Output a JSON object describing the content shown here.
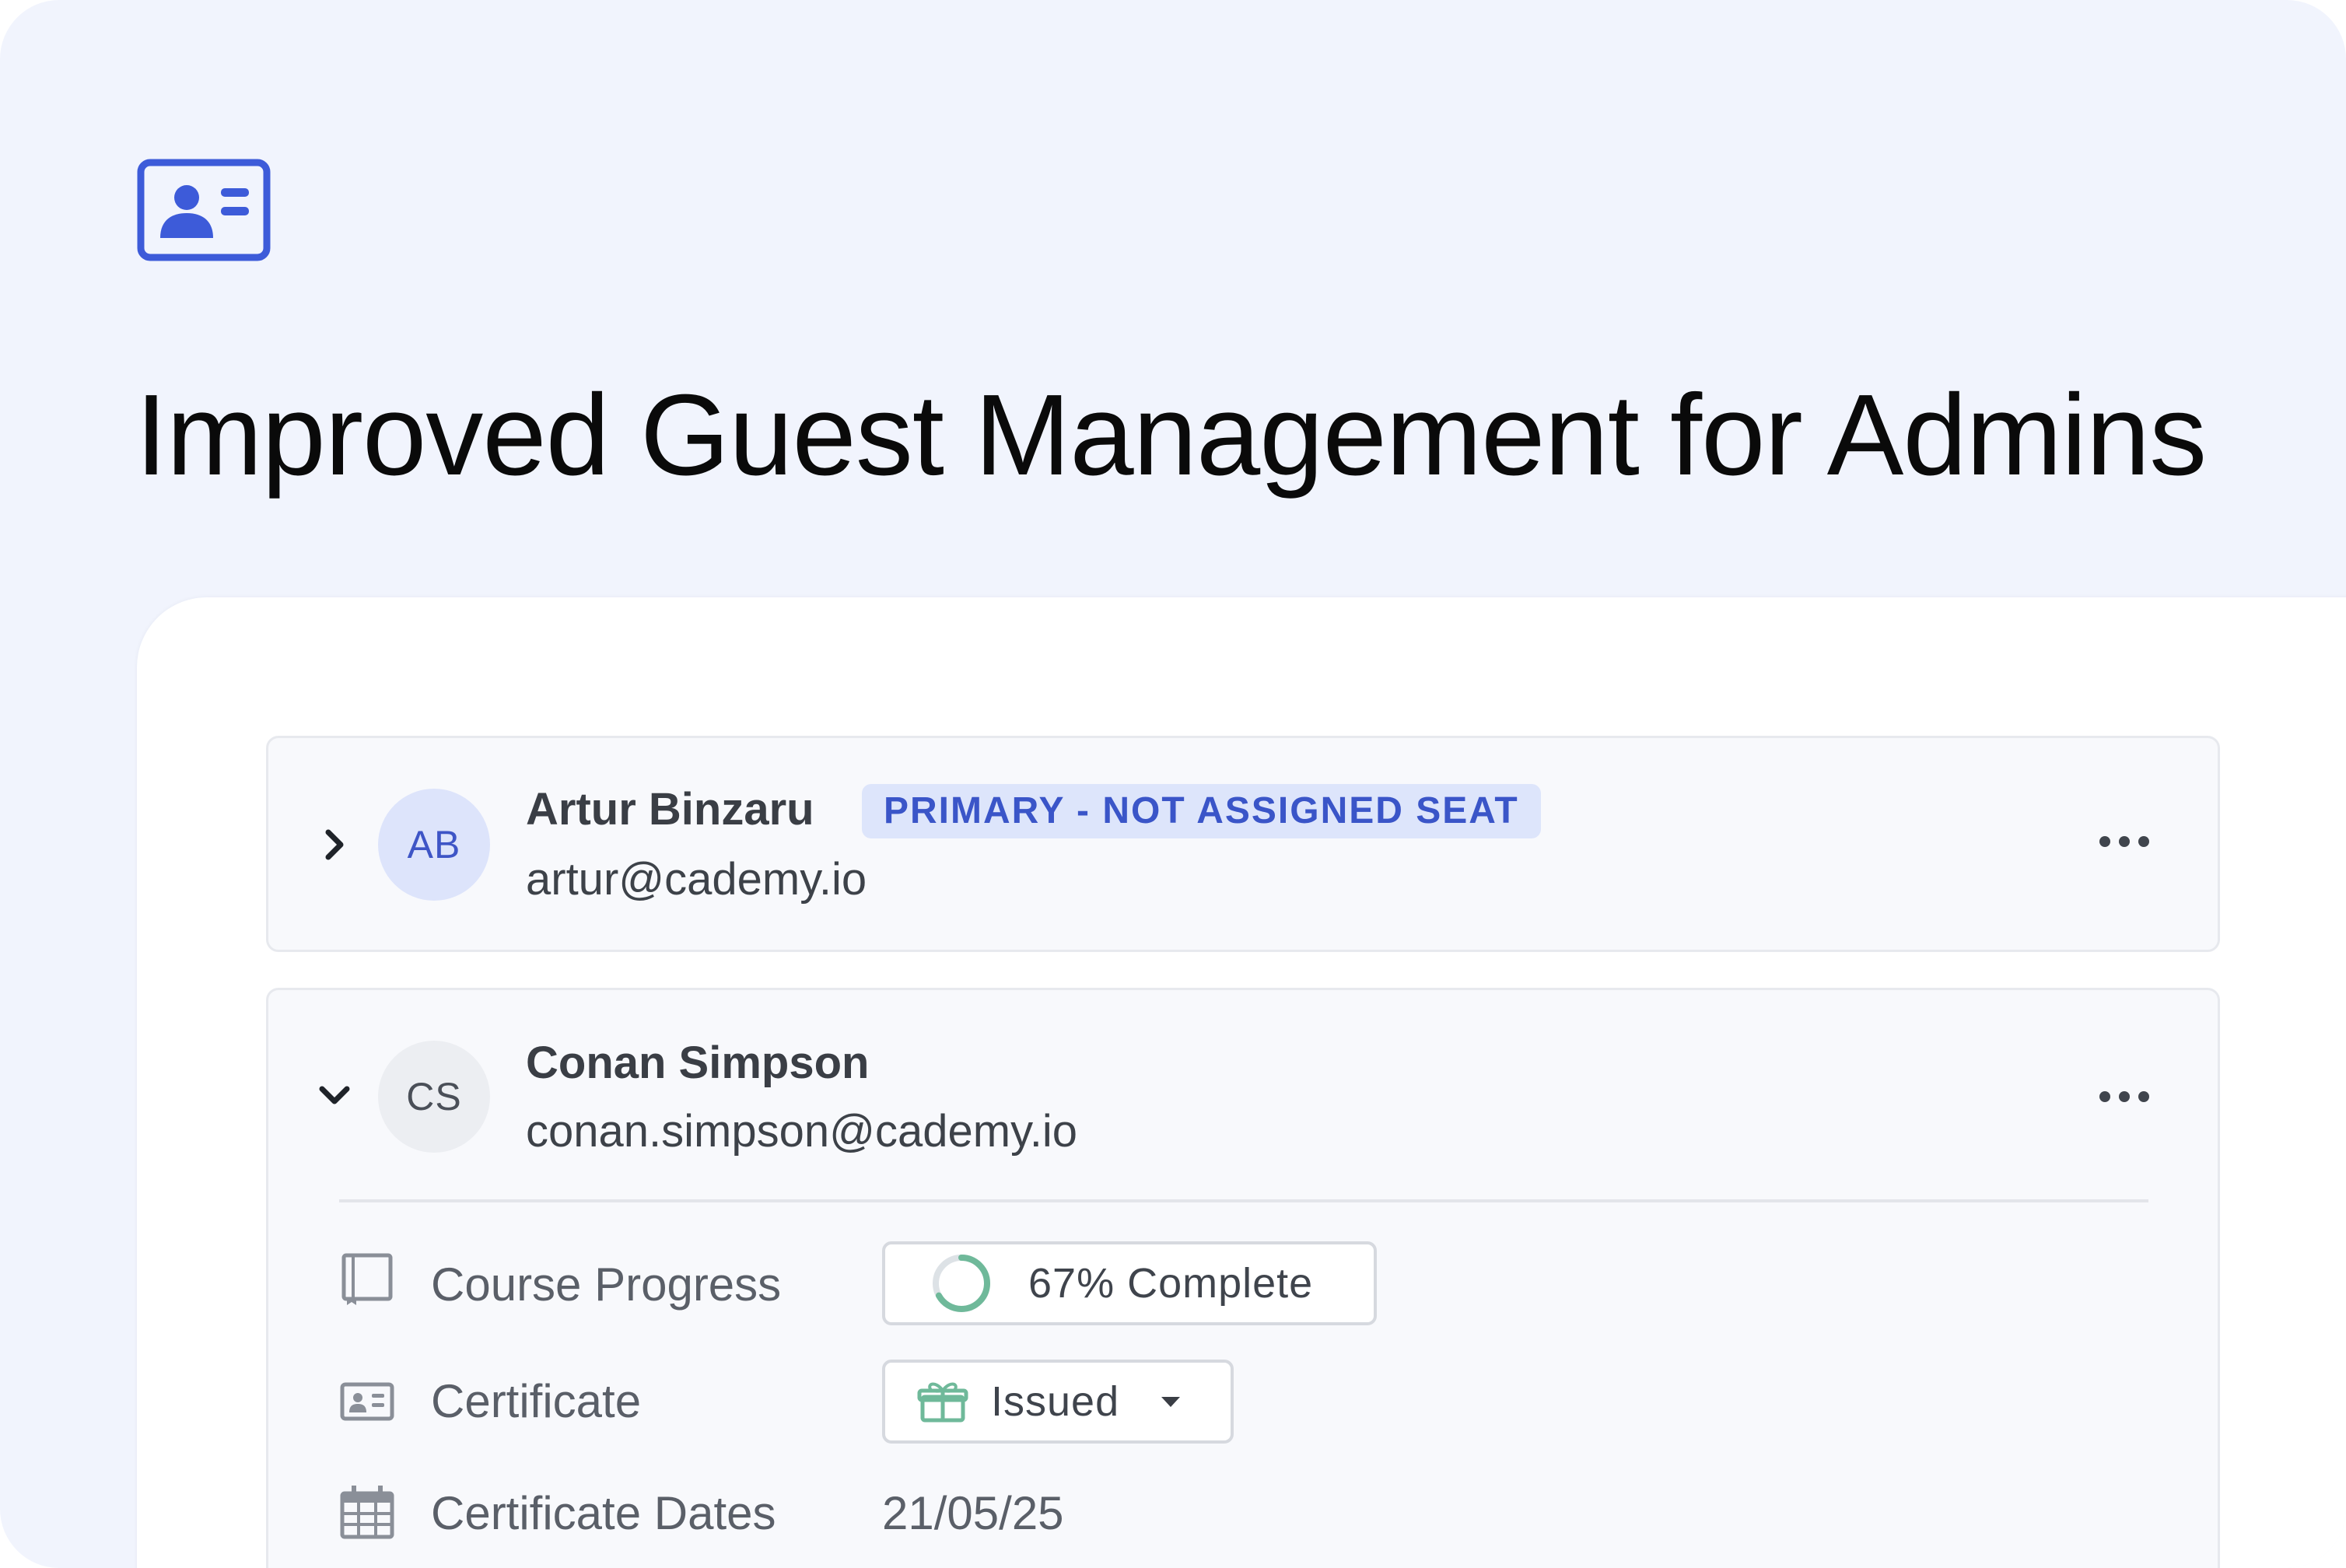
{
  "colors": {
    "background": "#f1f4fd",
    "accent": "#3d5bd9",
    "badge_bg": "#dde5fb",
    "badge_text": "#3a55c8",
    "progress_green": "#6fb99a"
  },
  "header": {
    "icon": "id-card-icon",
    "title": "Improved Guest Management for Admins"
  },
  "guests": [
    {
      "initials": "AB",
      "name": "Artur Binzaru",
      "badge": "PRIMARY - NOT ASSIGNED SEAT",
      "email": "artur@cademy.io",
      "expanded": false
    },
    {
      "initials": "CS",
      "name": "Conan Simpson",
      "email": "conan.simpson@cademy.io",
      "expanded": true,
      "details": {
        "course_progress": {
          "label": "Course Progress",
          "value_text": "67% Complete",
          "percent": 67
        },
        "certificate": {
          "label": "Certificate",
          "value": "Issued"
        },
        "certificate_dates": {
          "label": "Certificate Dates",
          "value": "21/05/25"
        }
      }
    }
  ]
}
